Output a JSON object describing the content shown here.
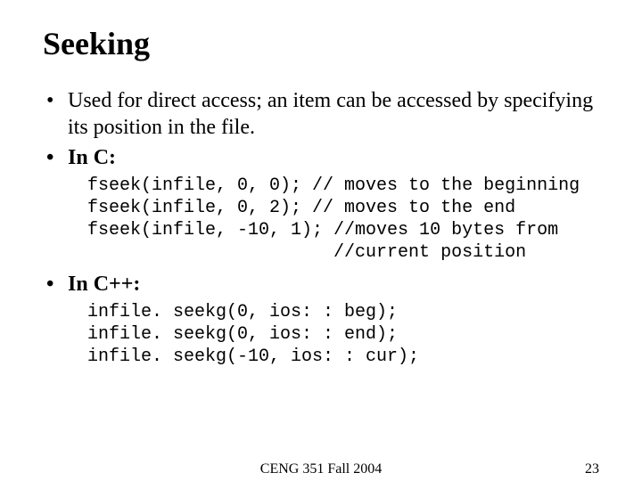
{
  "title": "Seeking",
  "bullets": {
    "intro": "Used for direct access; an item can be accessed by specifying its position in the file.",
    "c_label": "In C:",
    "cpp_label": "In C++:"
  },
  "code_c": "fseek(infile, 0, 0); // moves to the beginning\nfseek(infile, 0, 2); // moves to the end\nfseek(infile, -10, 1); //moves 10 bytes from\n                       //current position",
  "code_cpp": "infile. seekg(0, ios: : beg);\ninfile. seekg(0, ios: : end);\ninfile. seekg(-10, ios: : cur);",
  "footer": {
    "center": "CENG 351 Fall 2004",
    "page": "23"
  }
}
